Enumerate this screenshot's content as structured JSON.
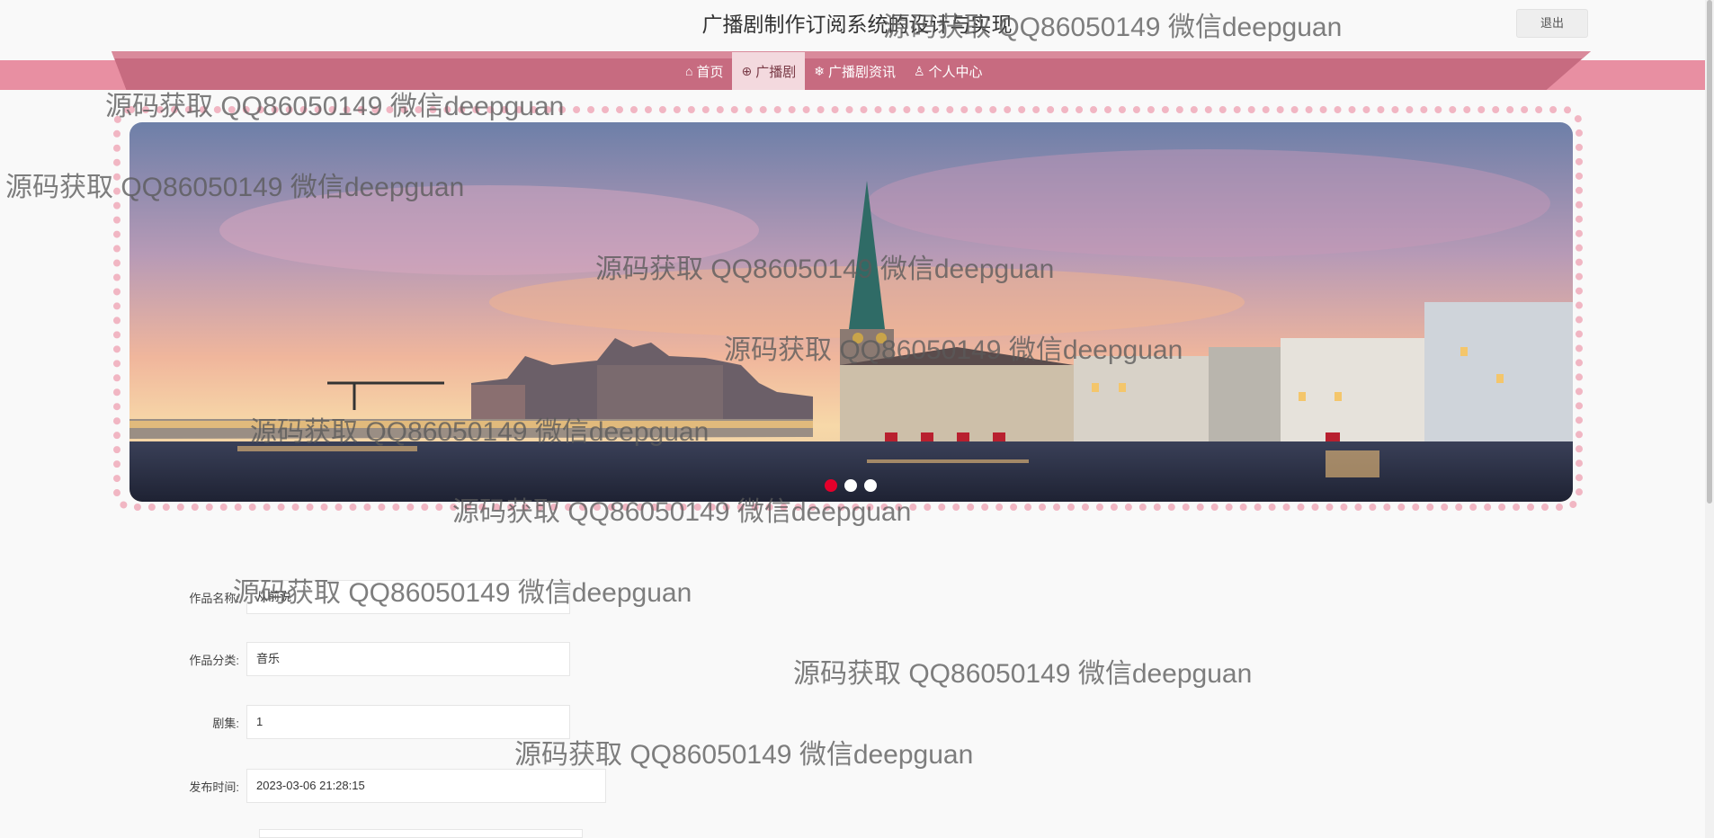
{
  "header": {
    "title": "广播剧制作订阅系统的设计与实现",
    "logout_label": "退出"
  },
  "nav": {
    "items": [
      {
        "label": "首页",
        "icon": "home-icon",
        "glyph": "⌂"
      },
      {
        "label": "广播剧",
        "icon": "book-icon",
        "glyph": "⊕"
      },
      {
        "label": "广播剧资讯",
        "icon": "snowflake-icon",
        "glyph": "❄"
      },
      {
        "label": "个人中心",
        "icon": "user-icon",
        "glyph": "♙"
      }
    ],
    "active_index": 1
  },
  "banner": {
    "slide_count": 3,
    "active_slide": 0
  },
  "form": {
    "name_label": "作品名称:",
    "name_value": "从前说",
    "category_label": "作品分类:",
    "category_value": "音乐",
    "episodes_label": "剧集:",
    "episodes_value": "1",
    "publish_time_label": "发布时间:",
    "publish_time_value": "2023-03-06 21:28:15"
  },
  "watermark": {
    "text": "源码获取 QQ86050149 微信deepguan"
  },
  "colors": {
    "nav": "#c76b80",
    "nav_band": "#e88fa2",
    "active_tab": "#f3d9de",
    "dot_active": "#e4002b",
    "frame": "#f1b6c3"
  }
}
